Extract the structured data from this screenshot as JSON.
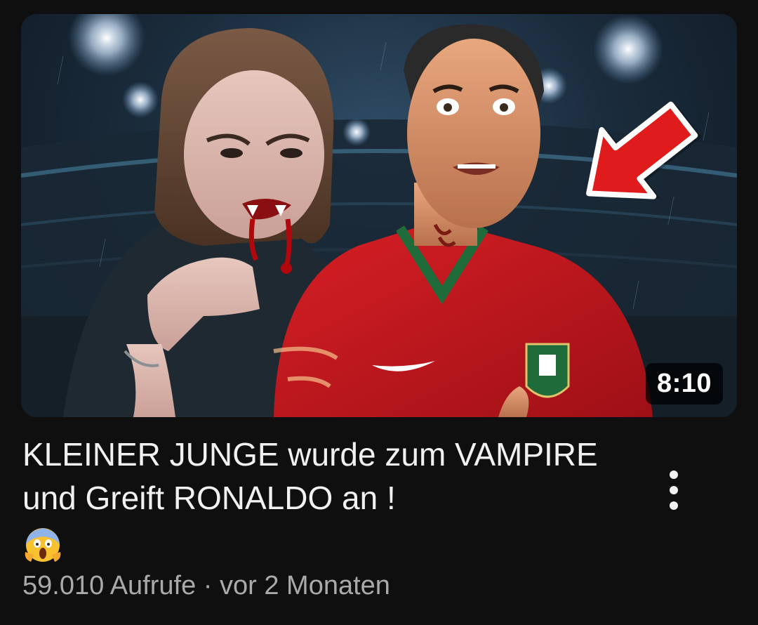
{
  "video": {
    "title": "KLEINER JUNGE wurde zum VAMPIRE und Greift RONALDO an !",
    "title_emoji": "😱",
    "duration": "8:10",
    "views": "59.010 Aufrufe",
    "separator": "·",
    "age": "vor 2 Monaten"
  },
  "icons": {
    "more": "vertical-ellipsis-icon",
    "arrow": "red-arrow-icon"
  },
  "colors": {
    "background": "#0f0f0f",
    "title": "#f1f1f1",
    "meta": "#aaaaaa",
    "jersey_red": "#c8161d",
    "jersey_green": "#1f6b3a",
    "arrow_red": "#e01b1b"
  }
}
